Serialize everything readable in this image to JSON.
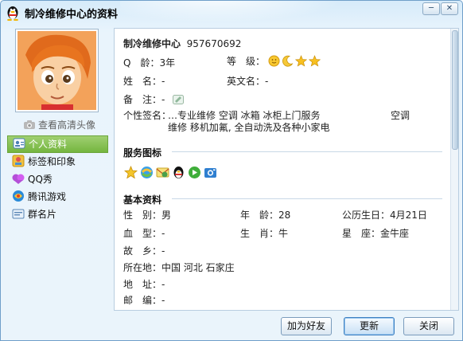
{
  "window": {
    "title": "制冷维修中心的资料",
    "minimize_glyph": "─",
    "close_glyph": "✕"
  },
  "sidebar": {
    "hd_avatar_link": "查看高清头像",
    "items": [
      {
        "label": "个人资料",
        "icon": "profile-card-icon",
        "active": true
      },
      {
        "label": "标签和印象",
        "icon": "tag-impression-icon",
        "active": false
      },
      {
        "label": "QQ秀",
        "icon": "qq-show-icon",
        "active": false
      },
      {
        "label": "腾讯游戏",
        "icon": "tencent-games-icon",
        "active": false
      },
      {
        "label": "群名片",
        "icon": "group-card-icon",
        "active": false
      }
    ]
  },
  "profile": {
    "nickname": "制冷维修中心",
    "qq_number": "957670692",
    "age_label": "Q　龄：",
    "age_value": "3年",
    "level_label": "等　级：",
    "level_icons": [
      "sun-icon",
      "moon-icon",
      "star-icon",
      "star-icon"
    ],
    "name_label": "姓　名：",
    "name_value": "-",
    "english_name_label": "英文名：",
    "english_name_value": "-",
    "note_label": "备　注：",
    "note_value": "-",
    "signature_label": "个性签名：",
    "signature_line1": "…专业维修  空调  冰箱  冰柜上门服务",
    "signature_line1_tail": "空调",
    "signature_line2": "维修  移机加氟, 全自动洗及各种小家电"
  },
  "services": {
    "title": "服务图标",
    "icons": [
      "qq-star-icon",
      "qq-browser-icon",
      "qq-mail-icon",
      "qq-penguin-icon",
      "qq-games-icon",
      "qq-camera-icon"
    ]
  },
  "basic": {
    "title": "基本资料",
    "gender_label": "性　别：",
    "gender_value": "男",
    "age_label": "年　龄：",
    "age_value": "28",
    "birthday_label": "公历生日：",
    "birthday_value": "4月21日",
    "blood_label": "血　型：",
    "blood_value": "-",
    "zodiac_label": "生　肖：",
    "zodiac_value": "牛",
    "constellation_label": "星　座：",
    "constellation_value": "金牛座",
    "hometown_label": "故　乡：",
    "hometown_value": "-",
    "location_label": "所在地：",
    "location_value": "中国 河北 石家庄",
    "address_label": "地　址：",
    "address_value": "-",
    "postcode_label": "邮　编：",
    "postcode_value": "-"
  },
  "footer": {
    "add_friend": "加为好友",
    "refresh": "更新",
    "close": "关闭"
  },
  "colors": {
    "accent": "#6aa53a",
    "window_border": "#6f9fc9",
    "section_line": "#c8d8e6"
  }
}
